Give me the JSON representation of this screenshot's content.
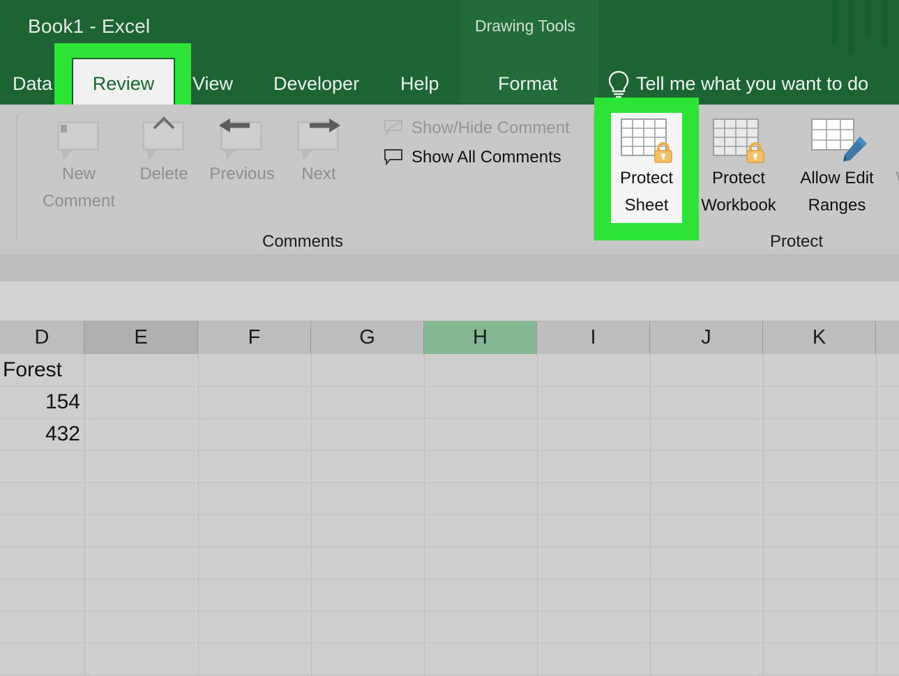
{
  "window": {
    "title": "Book1  -  Excel",
    "contextual_title": "Drawing Tools",
    "theme_green": "#1d6334",
    "highlight_green": "#2ce337"
  },
  "tabs": [
    {
      "label": "Data",
      "active": false
    },
    {
      "label": "Review",
      "active": true
    },
    {
      "label": "View",
      "active": false
    },
    {
      "label": "Developer",
      "active": false
    },
    {
      "label": "Help",
      "active": false
    },
    {
      "label": "Format",
      "active": false
    }
  ],
  "tellme": {
    "label": "Tell me what you want to do",
    "icon": "lightbulb-icon"
  },
  "ribbon": {
    "groups": [
      {
        "name": "Comments",
        "label": "Comments",
        "big_buttons": [
          {
            "label_line1": "New",
            "label_line2": "Comment",
            "icon": "new-comment-icon",
            "enabled": false
          },
          {
            "label_line1": "Delete",
            "label_line2": "",
            "icon": "delete-comment-icon",
            "enabled": false
          },
          {
            "label_line1": "Previous",
            "label_line2": "",
            "icon": "previous-comment-icon",
            "enabled": false
          },
          {
            "label_line1": "Next",
            "label_line2": "",
            "icon": "next-comment-icon",
            "enabled": false
          }
        ],
        "small_buttons": [
          {
            "label": "Show/Hide Comment",
            "icon": "show-hide-comment-icon",
            "enabled": false
          },
          {
            "label": "Show All Comments",
            "icon": "show-all-comments-icon",
            "enabled": true
          }
        ]
      },
      {
        "name": "Protect",
        "label": "Protect",
        "big_buttons": [
          {
            "label_line1": "Protect",
            "label_line2": "Sheet",
            "icon": "protect-sheet-icon",
            "enabled": true,
            "highlighted": true
          },
          {
            "label_line1": "Protect",
            "label_line2": "Workbook",
            "icon": "protect-workbook-icon",
            "enabled": true
          },
          {
            "label_line1": "Allow Edit",
            "label_line2": "Ranges",
            "icon": "allow-edit-ranges-icon",
            "enabled": true
          },
          {
            "label_line1": "W",
            "label_line2": "",
            "icon": "clipped-button-icon",
            "enabled": true
          }
        ]
      }
    ]
  },
  "sheet": {
    "columns": [
      {
        "label": "D",
        "state": "normal"
      },
      {
        "label": "E",
        "state": "hover"
      },
      {
        "label": "F",
        "state": "normal"
      },
      {
        "label": "G",
        "state": "normal"
      },
      {
        "label": "H",
        "state": "selected"
      },
      {
        "label": "I",
        "state": "normal"
      },
      {
        "label": "J",
        "state": "normal"
      },
      {
        "label": "K",
        "state": "normal"
      }
    ],
    "cells": [
      {
        "column": "D",
        "row": 1,
        "value": "Forest",
        "align": "left"
      },
      {
        "column": "D",
        "row": 2,
        "value": "154",
        "align": "right"
      },
      {
        "column": "D",
        "row": 3,
        "value": "432",
        "align": "right"
      }
    ],
    "selected_column_color": "#84b894",
    "hover_column_color": "#b0b0b0"
  }
}
